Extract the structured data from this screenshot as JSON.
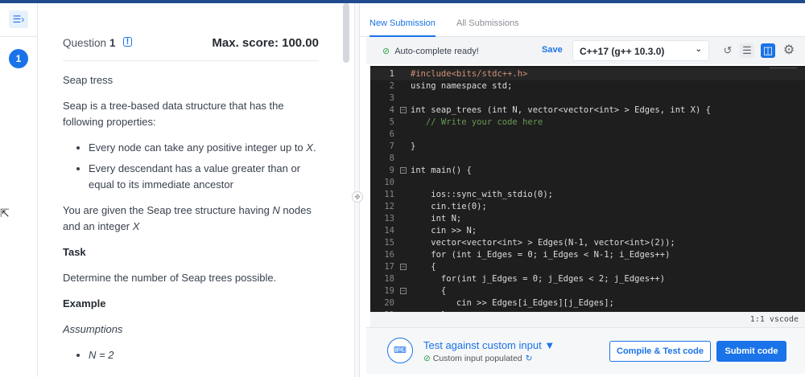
{
  "sidebar": {
    "toggle_icon": "collapse-panel-icon",
    "questions": [
      "1"
    ]
  },
  "question": {
    "label": "Question",
    "number": "1",
    "max_score": "Max. score: 100.00",
    "title": "Seap tress",
    "intro": "Seap is a tree-based data structure that has the following properties:",
    "properties": [
      {
        "text": "Every node can take any positive integer up to ",
        "var": "X",
        "end": "."
      },
      {
        "text": "Every descendant has a value greater than or equal to its immediate ancestor",
        "var": "",
        "end": ""
      }
    ],
    "given_pre": "You are given the Seap tree structure having ",
    "given_n": "N",
    "given_mid": " nodes and an integer ",
    "given_x": "X",
    "task_heading": "Task",
    "task_text": "Determine the number of Seap trees possible.",
    "example_heading": "Example",
    "assumptions_heading": "Assumptions",
    "assumptions": [
      "N = 2"
    ]
  },
  "tabs": [
    {
      "label": "New Submission",
      "active": true
    },
    {
      "label": "All Submissions",
      "active": false
    }
  ],
  "toolbar": {
    "autocomplete": "Auto-complete ready!",
    "save": "Save",
    "language": "C++17 (g++ 10.3.0)",
    "icons": [
      "reset-icon",
      "horizontal-layout-icon",
      "vertical-layout-icon",
      "settings-icon"
    ]
  },
  "editor": {
    "lines": [
      "#include<bits/stdc++.h>",
      "using namespace std;",
      "",
      "int seap_trees (int N, vector<vector<int> > Edges, int X) {",
      "   // Write your code here",
      "",
      "}",
      "",
      "int main() {",
      "",
      "    ios::sync_with_stdio(0);",
      "    cin.tie(0);",
      "    int N;",
      "    cin >> N;",
      "    vector<vector<int> > Edges(N-1, vector<int>(2));",
      "    for (int i_Edges = 0; i_Edges < N-1; i_Edges++)",
      "    {",
      "      for(int j_Edges = 0; j_Edges < 2; j_Edges++)",
      "      {",
      "         cin >> Edges[i_Edges][j_Edges];",
      "      }"
    ],
    "foldable_lines": [
      4,
      9,
      17,
      19
    ],
    "status": "1:1  vscode"
  },
  "bottom": {
    "test_custom": "Test against custom input",
    "custom_status": "Custom input populated",
    "compile": "Compile & Test code",
    "submit": "Submit code"
  },
  "colors": {
    "accent": "#1a73e8",
    "editor_bg": "#1e1e1e",
    "success": "#2ea44f"
  }
}
